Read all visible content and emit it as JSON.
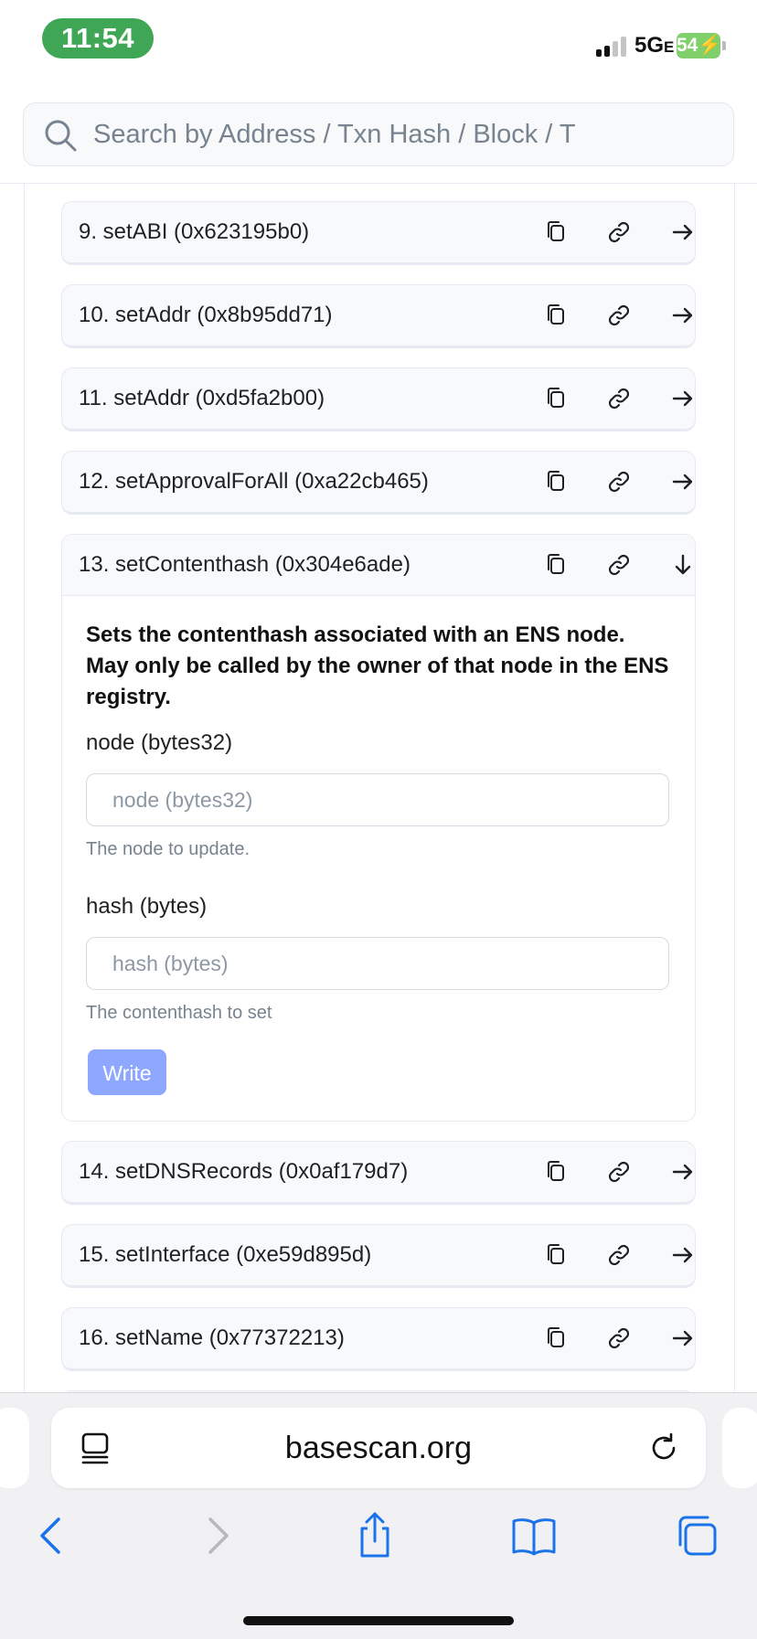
{
  "status_bar": {
    "time": "11:54",
    "network": "5G",
    "network_suffix": "E",
    "battery": "54",
    "time_color": "#3fa655"
  },
  "search": {
    "placeholder": "Search by Address / Txn Hash / Block / T"
  },
  "functions": [
    {
      "label": "9. setABI (0x623195b0)",
      "expanded": false
    },
    {
      "label": "10. setAddr (0x8b95dd71)",
      "expanded": false
    },
    {
      "label": "11. setAddr (0xd5fa2b00)",
      "expanded": false
    },
    {
      "label": "12. setApprovalForAll (0xa22cb465)",
      "expanded": false
    },
    {
      "label": "13. setContenthash (0x304e6ade)",
      "expanded": true
    },
    {
      "label": "14. setDNSRecords (0x0af179d7)",
      "expanded": false
    },
    {
      "label": "15. setInterface (0xe59d895d)",
      "expanded": false
    },
    {
      "label": "16. setName (0x77372213)",
      "expanded": false
    }
  ],
  "expanded_function": {
    "description": "Sets the contenthash associated with an ENS node. May only be called by the owner of that node in the ENS registry.",
    "params": [
      {
        "label": "node (bytes32)",
        "placeholder": "node (bytes32)",
        "help": "The node to update."
      },
      {
        "label": "hash (bytes)",
        "placeholder": "hash (bytes)",
        "help": "The contenthash to set"
      }
    ],
    "write_label": "Write",
    "write_color": "#8fa8ff"
  },
  "browser": {
    "url": "basescan.org"
  },
  "icons": {
    "copy": "copy-icon",
    "link": "link-icon",
    "arrow_right": "arrow-right-icon",
    "arrow_down": "arrow-down-icon"
  }
}
